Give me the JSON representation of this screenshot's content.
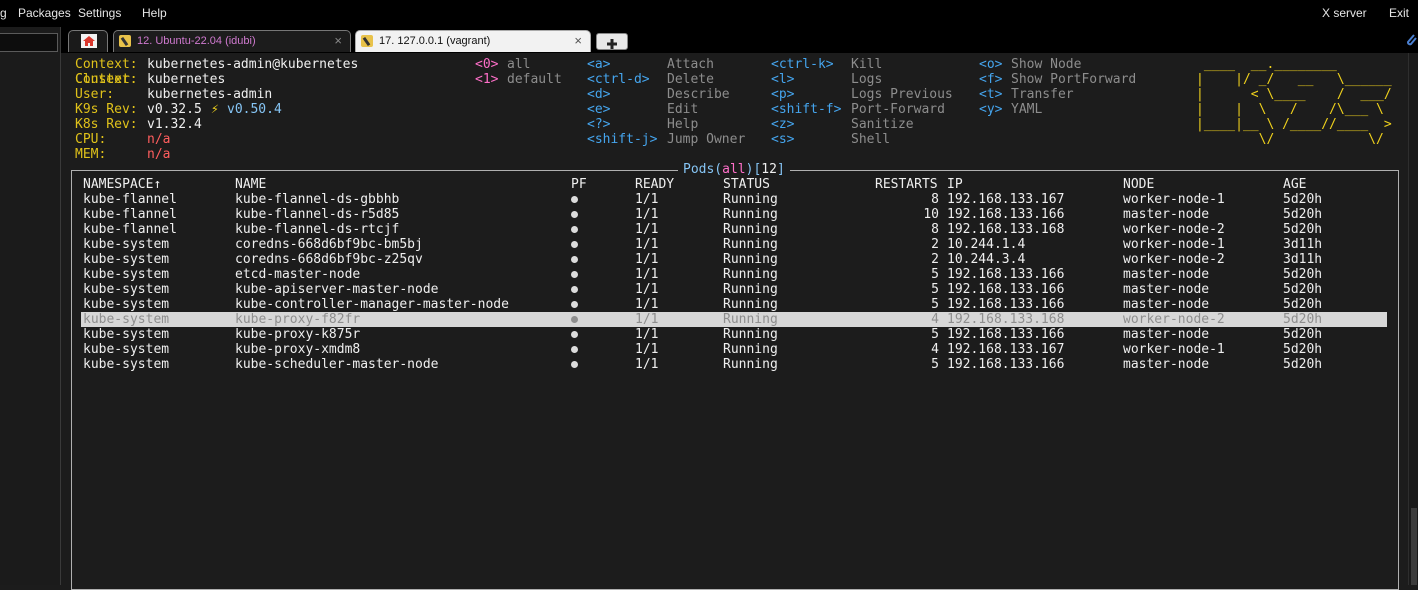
{
  "menubar": {
    "items": [
      "g",
      "Packages",
      "Settings",
      "Help"
    ],
    "right": [
      "X server",
      "Exit"
    ]
  },
  "tabs": [
    {
      "label": "12. Ubuntu-22.04 (idubi)",
      "close": "×"
    },
    {
      "label": "17. 127.0.0.1 (vagrant)",
      "close": "×"
    }
  ],
  "info": {
    "context": {
      "label": "Context:",
      "value": "kubernetes-admin@kubernetes"
    },
    "cluster": {
      "label": "Cluster:",
      "value": "kubernetes"
    },
    "user": {
      "label": "User:",
      "value": "kubernetes-admin"
    },
    "k9s": {
      "label": "K9s Rev:",
      "value": "v0.32.5",
      "sep": "⚡",
      "latest": "v0.50.4"
    },
    "k8s": {
      "label": "K8s Rev:",
      "value": "v1.32.4"
    },
    "cpu": {
      "label": "CPU:",
      "value": "n/a"
    },
    "mem": {
      "label": "MEM:",
      "value": "n/a"
    }
  },
  "namespaces": [
    {
      "key": "<0>",
      "name": "all"
    },
    {
      "key": "<1>",
      "name": "default"
    }
  ],
  "keybinds": {
    "col1": [
      {
        "key": "<a>",
        "action": "Attach"
      },
      {
        "key": "<ctrl-d>",
        "action": "Delete"
      },
      {
        "key": "<d>",
        "action": "Describe"
      },
      {
        "key": "<e>",
        "action": "Edit"
      },
      {
        "key": "<?>",
        "action": "Help"
      },
      {
        "key": "<shift-j>",
        "action": "Jump Owner"
      }
    ],
    "col2": [
      {
        "key": "<ctrl-k>",
        "action": "Kill"
      },
      {
        "key": "<l>",
        "action": "Logs"
      },
      {
        "key": "<p>",
        "action": "Logs Previous"
      },
      {
        "key": "<shift-f>",
        "action": "Port-Forward"
      },
      {
        "key": "<z>",
        "action": "Sanitize"
      },
      {
        "key": "<s>",
        "action": "Shell"
      }
    ],
    "col3": [
      {
        "key": "<o>",
        "action": "Show Node"
      },
      {
        "key": "<f>",
        "action": "Show PortForward"
      },
      {
        "key": "<t>",
        "action": "Transfer"
      },
      {
        "key": "<y>",
        "action": "YAML"
      }
    ]
  },
  "logo_lines": [
    " ____  __.________       ",
    "|    |/ _/   __   \\______",
    "|      < \\____    /  ___/",
    "|    |  \\   /    /\\___ \\ ",
    "|____|__ \\ /____//____  >",
    "        \\/            \\/ "
  ],
  "panel": {
    "title_prefix": "Pods(",
    "title_ns": "all",
    "title_mid": ")[",
    "title_count": "12",
    "title_suffix": "]"
  },
  "table": {
    "columns": [
      "NAMESPACE↑",
      "NAME",
      "PF",
      "READY",
      "STATUS",
      "RESTARTS",
      "IP",
      "NODE",
      "AGE"
    ],
    "selected_index": 8,
    "rows": [
      {
        "ns": "kube-flannel",
        "name": "kube-flannel-ds-gbbhb",
        "ready": "1/1",
        "status": "Running",
        "restarts": "8",
        "ip": "192.168.133.167",
        "node": "worker-node-1",
        "age": "5d20h"
      },
      {
        "ns": "kube-flannel",
        "name": "kube-flannel-ds-r5d85",
        "ready": "1/1",
        "status": "Running",
        "restarts": "10",
        "ip": "192.168.133.166",
        "node": "master-node",
        "age": "5d20h"
      },
      {
        "ns": "kube-flannel",
        "name": "kube-flannel-ds-rtcjf",
        "ready": "1/1",
        "status": "Running",
        "restarts": "8",
        "ip": "192.168.133.168",
        "node": "worker-node-2",
        "age": "5d20h"
      },
      {
        "ns": "kube-system",
        "name": "coredns-668d6bf9bc-bm5bj",
        "ready": "1/1",
        "status": "Running",
        "restarts": "2",
        "ip": "10.244.1.4",
        "node": "worker-node-1",
        "age": "3d11h"
      },
      {
        "ns": "kube-system",
        "name": "coredns-668d6bf9bc-z25qv",
        "ready": "1/1",
        "status": "Running",
        "restarts": "2",
        "ip": "10.244.3.4",
        "node": "worker-node-2",
        "age": "3d11h"
      },
      {
        "ns": "kube-system",
        "name": "etcd-master-node",
        "ready": "1/1",
        "status": "Running",
        "restarts": "5",
        "ip": "192.168.133.166",
        "node": "master-node",
        "age": "5d20h"
      },
      {
        "ns": "kube-system",
        "name": "kube-apiserver-master-node",
        "ready": "1/1",
        "status": "Running",
        "restarts": "5",
        "ip": "192.168.133.166",
        "node": "master-node",
        "age": "5d20h"
      },
      {
        "ns": "kube-system",
        "name": "kube-controller-manager-master-node",
        "ready": "1/1",
        "status": "Running",
        "restarts": "5",
        "ip": "192.168.133.166",
        "node": "master-node",
        "age": "5d20h"
      },
      {
        "ns": "kube-system",
        "name": "kube-proxy-f82fr",
        "ready": "1/1",
        "status": "Running",
        "restarts": "4",
        "ip": "192.168.133.168",
        "node": "worker-node-2",
        "age": "5d20h"
      },
      {
        "ns": "kube-system",
        "name": "kube-proxy-k875r",
        "ready": "1/1",
        "status": "Running",
        "restarts": "5",
        "ip": "192.168.133.166",
        "node": "master-node",
        "age": "5d20h"
      },
      {
        "ns": "kube-system",
        "name": "kube-proxy-xmdm8",
        "ready": "1/1",
        "status": "Running",
        "restarts": "4",
        "ip": "192.168.133.167",
        "node": "worker-node-1",
        "age": "5d20h"
      },
      {
        "ns": "kube-system",
        "name": "kube-scheduler-master-node",
        "ready": "1/1",
        "status": "Running",
        "restarts": "5",
        "ip": "192.168.133.166",
        "node": "master-node",
        "age": "5d20h"
      }
    ]
  }
}
